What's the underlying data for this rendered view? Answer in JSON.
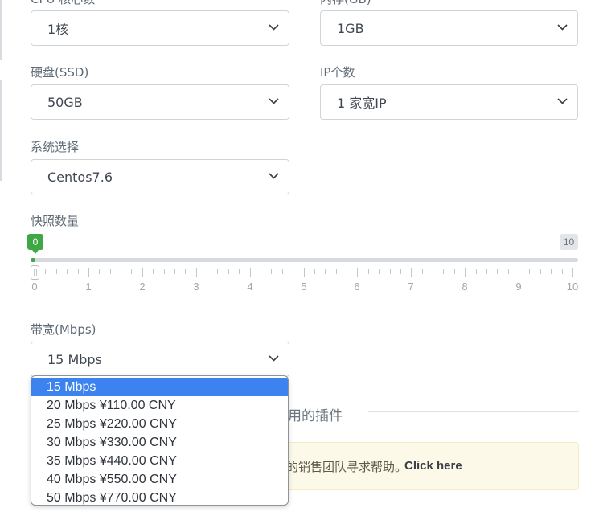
{
  "fields": {
    "cpu": {
      "label": "CPU 核心数",
      "value": "1核"
    },
    "memory": {
      "label": "内存(GB)",
      "value": "1GB"
    },
    "disk": {
      "label": "硬盘(SSD)",
      "value": "50GB"
    },
    "ip_count": {
      "label": "IP个数",
      "value": "1 家宽IP"
    },
    "os": {
      "label": "系统选择",
      "value": "Centos7.6"
    },
    "bandwidth": {
      "label": "带宽(Mbps)",
      "value": "15 Mbps"
    }
  },
  "snapshots": {
    "label": "快照数量",
    "min_label": "0",
    "max_label": "10",
    "value": 0,
    "min": 0,
    "max": 10,
    "scale": [
      "0",
      "1",
      "2",
      "3",
      "4",
      "5",
      "6",
      "7",
      "8",
      "9",
      "10"
    ]
  },
  "bandwidth_options": [
    "15 Mbps",
    "20 Mbps ¥110.00 CNY",
    "25 Mbps ¥220.00 CNY",
    "30 Mbps ¥330.00 CNY",
    "35 Mbps ¥440.00 CNY",
    "40 Mbps ¥550.00 CNY",
    "50 Mbps ¥770.00 CNY"
  ],
  "addons": {
    "heading_partial": "用的插件"
  },
  "notice": {
    "text_partial": "的销售团队寻求帮助。",
    "link": "Click here"
  },
  "colors": {
    "accent_green": "#3fa845",
    "selected_blue": "#3d83f0",
    "notice_bg": "#fdf9e8"
  }
}
